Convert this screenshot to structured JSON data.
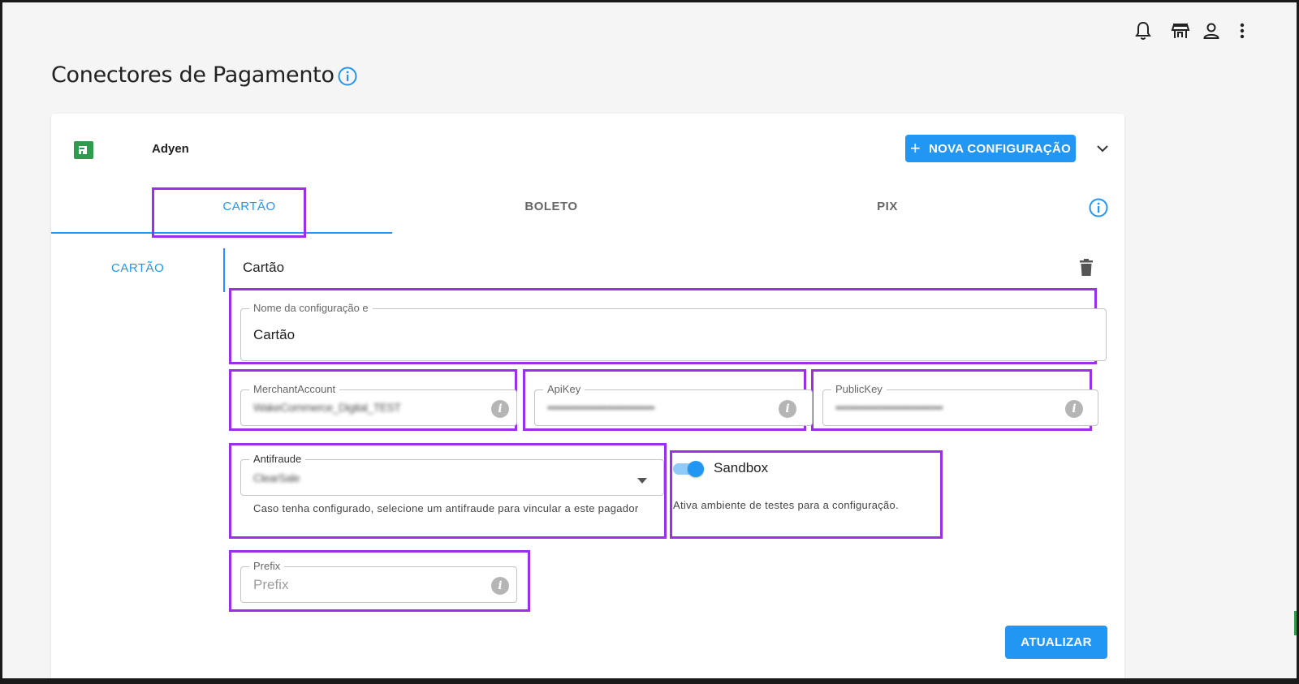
{
  "header": {
    "title": "Conectores de Pagamento"
  },
  "topbar": {
    "icons": [
      "bell-icon",
      "store-icon",
      "user-icon",
      "more-vert-icon"
    ]
  },
  "connector": {
    "name": "Adyen",
    "new_config_label": "NOVA CONFIGURAÇÃO",
    "tabs": [
      {
        "label": "CARTÃO",
        "active": true
      },
      {
        "label": "BOLETO",
        "active": false
      },
      {
        "label": "PIX",
        "active": false
      }
    ],
    "side_items": [
      {
        "label": "CARTÃO",
        "active": true
      }
    ]
  },
  "form": {
    "section_title": "Cartão",
    "config_name": {
      "label": "Nome da configuração e",
      "value": "Cartão"
    },
    "merchant_account": {
      "label": "MerchantAccount",
      "value": "WakeCommerce_Digital_TEST"
    },
    "api_key": {
      "label": "ApiKey",
      "value": "••••••••••••••••••••••••••••••"
    },
    "public_key": {
      "label": "PublicKey",
      "value": "••••••••••••••••••••••••••••••"
    },
    "antifraude": {
      "label": "Antifraude",
      "value": "ClearSale",
      "helper": "Caso tenha configurado, selecione um antifraude para vincular a este pagador"
    },
    "sandbox": {
      "label": "Sandbox",
      "enabled": true,
      "helper": "Ativa ambiente de testes para a configuração."
    },
    "prefix": {
      "label": "Prefix",
      "placeholder": "Prefix"
    },
    "update_label": "ATUALIZAR"
  },
  "colors": {
    "primary": "#2196f3",
    "highlight": "#9b30e8",
    "logo": "#2e9b4d"
  }
}
